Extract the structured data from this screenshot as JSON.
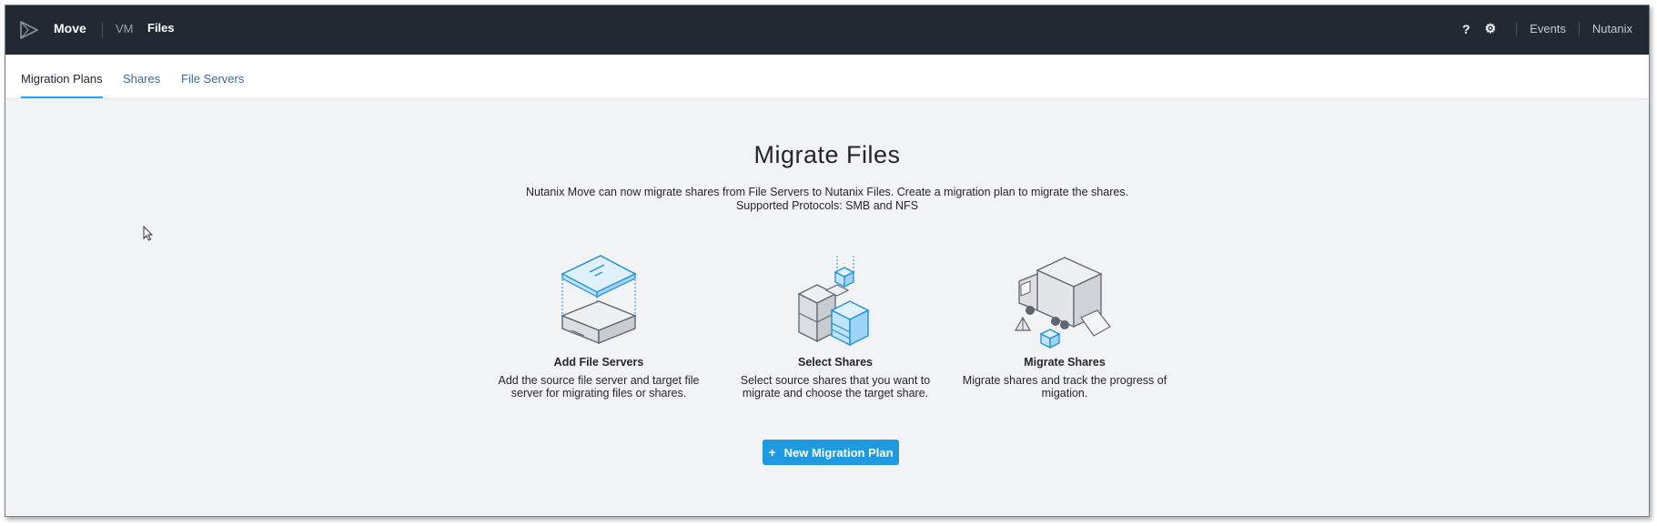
{
  "header": {
    "app_name": "Move",
    "nav": [
      "VM",
      "Files"
    ],
    "help_icon_glyph": "?",
    "settings_icon_glyph": "⚙",
    "events_label": "Events",
    "user_label": "Nutanix"
  },
  "tabs": [
    {
      "label": "Migration Plans",
      "active": true
    },
    {
      "label": "Shares",
      "active": false
    },
    {
      "label": "File Servers",
      "active": false
    }
  ],
  "main": {
    "title": "Migrate Files",
    "description_line1": "Nutanix Move can now migrate shares from File Servers to Nutanix Files. Create a migration plan to migrate the shares.",
    "description_line2": "Supported Protocols: SMB and NFS",
    "steps": [
      {
        "title": "Add File Servers",
        "line1": "Add the source file server and target file",
        "line2": "server for migrating files or shares.",
        "icon": "file-server-icon"
      },
      {
        "title": "Select Shares",
        "line1": "Select source shares that you want to",
        "line2": "migrate and choose the target share.",
        "icon": "shares-cubes-icon"
      },
      {
        "title": "Migrate Shares",
        "line1": "Migrate shares and track the progress of",
        "line2": "migation.",
        "icon": "truck-icon"
      }
    ],
    "new_plan_button": {
      "icon": "+",
      "label": "New Migration Plan"
    }
  },
  "colors": {
    "topbar": "#212933",
    "accent": "#1f9ae0",
    "tab_link": "#3d6a99",
    "background": "#f2f3f5"
  }
}
